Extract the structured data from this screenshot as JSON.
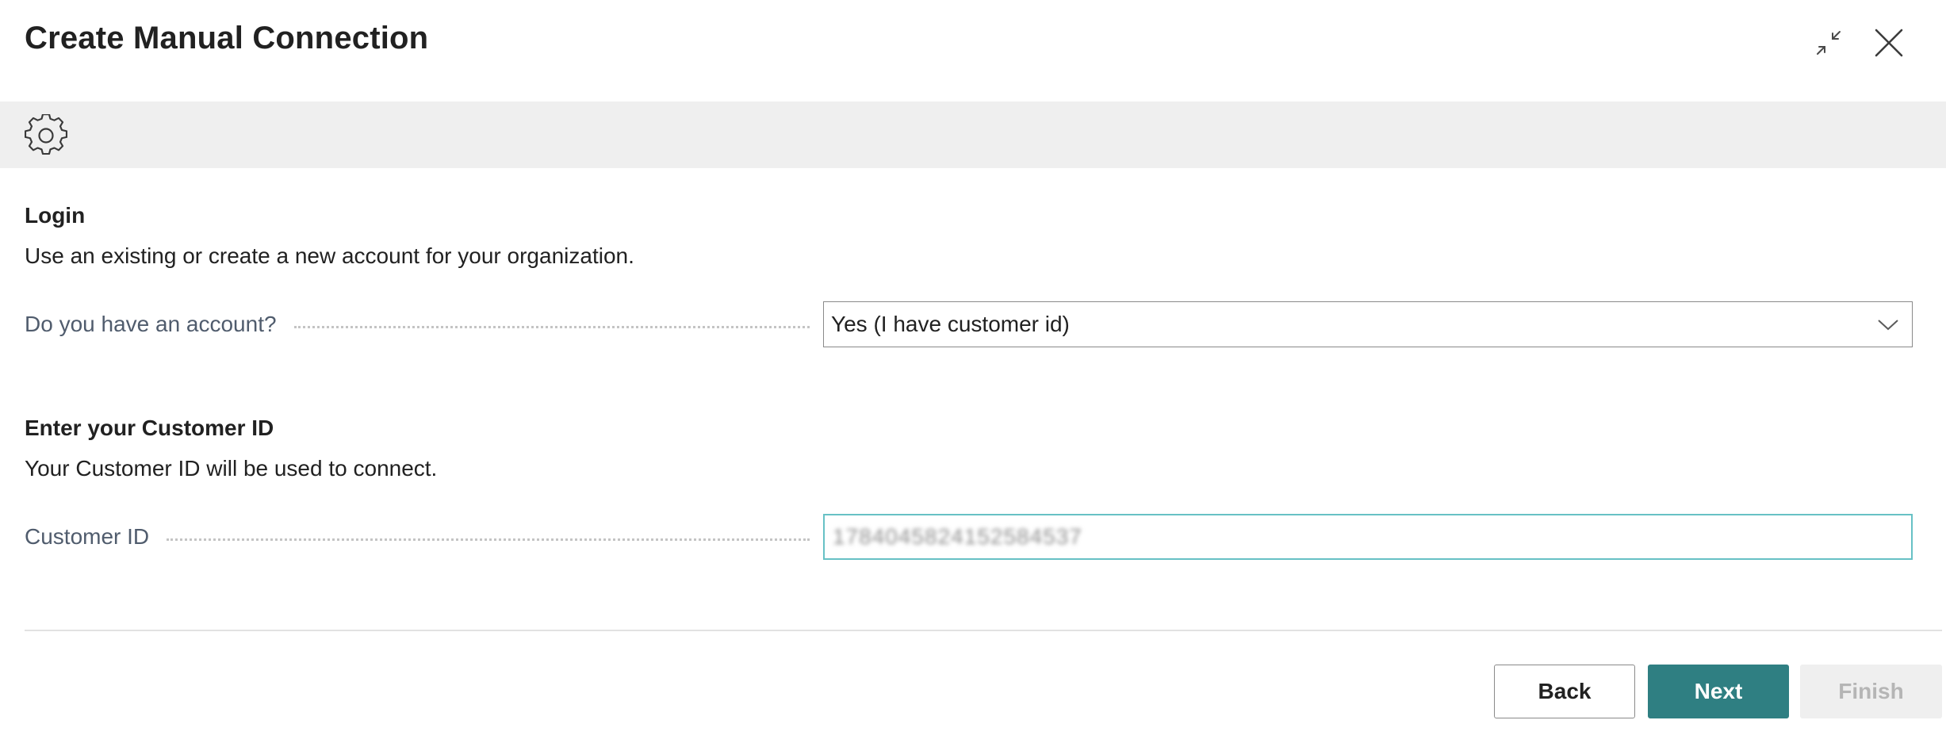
{
  "dialog": {
    "title": "Create Manual Connection",
    "header_icons": [
      "collapse-icon",
      "close-icon"
    ]
  },
  "actionbar": {
    "icon": "gear-icon"
  },
  "login": {
    "title": "Login",
    "description": "Use an existing or create a new account for your organization.",
    "account_label": "Do you have an account?",
    "account_value": "Yes (I have customer id)"
  },
  "customer": {
    "title": "Enter your Customer ID",
    "description": "Your Customer ID will be used to connect.",
    "id_label": "Customer ID",
    "id_value": "1784045824152584537"
  },
  "buttons": {
    "back": "Back",
    "next": "Next",
    "finish": "Finish"
  },
  "colors": {
    "accent": "#2f7f82",
    "focus_border": "#67c1c5",
    "actionbar_bg": "#efefef",
    "disabled_text": "#b5b5b5"
  }
}
